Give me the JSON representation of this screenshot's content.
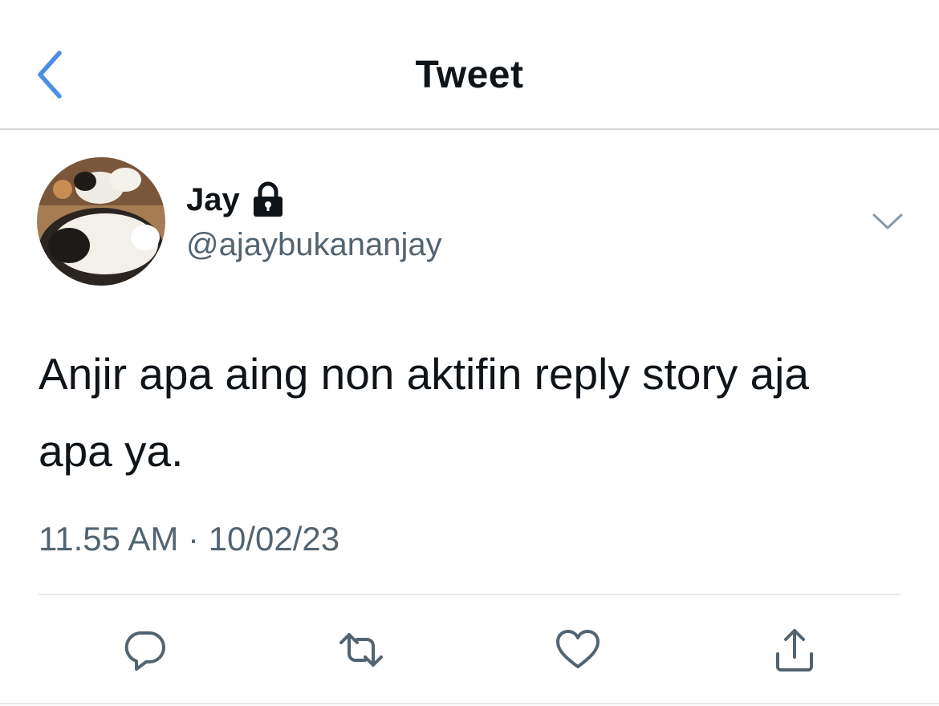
{
  "header": {
    "title": "Tweet",
    "back_icon": "chevron-left-icon",
    "accent": "#1d9bf0"
  },
  "tweet": {
    "author_name": "Jay",
    "author_handle": "@ajaybukananjay",
    "protected_icon": "lock-icon",
    "more_icon": "chevron-down-icon",
    "text": "Anjir apa aing non aktifin reply story aja apa ya.",
    "timestamp": "11.55 AM · 10/02/23"
  },
  "actions": [
    {
      "name": "reply",
      "icon": "reply-icon"
    },
    {
      "name": "retweet",
      "icon": "retweet-icon"
    },
    {
      "name": "like",
      "icon": "heart-icon"
    },
    {
      "name": "share",
      "icon": "share-icon"
    }
  ]
}
